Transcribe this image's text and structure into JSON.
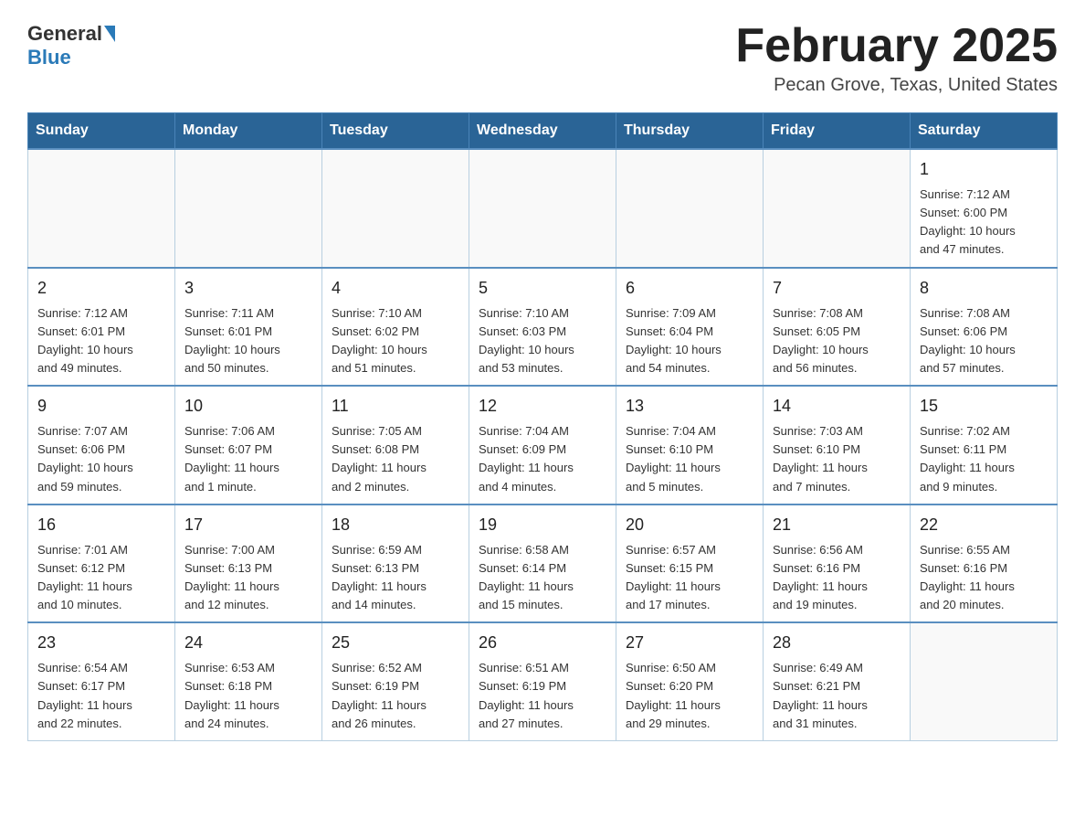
{
  "header": {
    "logo_general": "General",
    "logo_blue": "Blue",
    "month_title": "February 2025",
    "location": "Pecan Grove, Texas, United States"
  },
  "weekdays": [
    "Sunday",
    "Monday",
    "Tuesday",
    "Wednesday",
    "Thursday",
    "Friday",
    "Saturday"
  ],
  "weeks": [
    [
      {
        "day": "",
        "info": ""
      },
      {
        "day": "",
        "info": ""
      },
      {
        "day": "",
        "info": ""
      },
      {
        "day": "",
        "info": ""
      },
      {
        "day": "",
        "info": ""
      },
      {
        "day": "",
        "info": ""
      },
      {
        "day": "1",
        "info": "Sunrise: 7:12 AM\nSunset: 6:00 PM\nDaylight: 10 hours\nand 47 minutes."
      }
    ],
    [
      {
        "day": "2",
        "info": "Sunrise: 7:12 AM\nSunset: 6:01 PM\nDaylight: 10 hours\nand 49 minutes."
      },
      {
        "day": "3",
        "info": "Sunrise: 7:11 AM\nSunset: 6:01 PM\nDaylight: 10 hours\nand 50 minutes."
      },
      {
        "day": "4",
        "info": "Sunrise: 7:10 AM\nSunset: 6:02 PM\nDaylight: 10 hours\nand 51 minutes."
      },
      {
        "day": "5",
        "info": "Sunrise: 7:10 AM\nSunset: 6:03 PM\nDaylight: 10 hours\nand 53 minutes."
      },
      {
        "day": "6",
        "info": "Sunrise: 7:09 AM\nSunset: 6:04 PM\nDaylight: 10 hours\nand 54 minutes."
      },
      {
        "day": "7",
        "info": "Sunrise: 7:08 AM\nSunset: 6:05 PM\nDaylight: 10 hours\nand 56 minutes."
      },
      {
        "day": "8",
        "info": "Sunrise: 7:08 AM\nSunset: 6:06 PM\nDaylight: 10 hours\nand 57 minutes."
      }
    ],
    [
      {
        "day": "9",
        "info": "Sunrise: 7:07 AM\nSunset: 6:06 PM\nDaylight: 10 hours\nand 59 minutes."
      },
      {
        "day": "10",
        "info": "Sunrise: 7:06 AM\nSunset: 6:07 PM\nDaylight: 11 hours\nand 1 minute."
      },
      {
        "day": "11",
        "info": "Sunrise: 7:05 AM\nSunset: 6:08 PM\nDaylight: 11 hours\nand 2 minutes."
      },
      {
        "day": "12",
        "info": "Sunrise: 7:04 AM\nSunset: 6:09 PM\nDaylight: 11 hours\nand 4 minutes."
      },
      {
        "day": "13",
        "info": "Sunrise: 7:04 AM\nSunset: 6:10 PM\nDaylight: 11 hours\nand 5 minutes."
      },
      {
        "day": "14",
        "info": "Sunrise: 7:03 AM\nSunset: 6:10 PM\nDaylight: 11 hours\nand 7 minutes."
      },
      {
        "day": "15",
        "info": "Sunrise: 7:02 AM\nSunset: 6:11 PM\nDaylight: 11 hours\nand 9 minutes."
      }
    ],
    [
      {
        "day": "16",
        "info": "Sunrise: 7:01 AM\nSunset: 6:12 PM\nDaylight: 11 hours\nand 10 minutes."
      },
      {
        "day": "17",
        "info": "Sunrise: 7:00 AM\nSunset: 6:13 PM\nDaylight: 11 hours\nand 12 minutes."
      },
      {
        "day": "18",
        "info": "Sunrise: 6:59 AM\nSunset: 6:13 PM\nDaylight: 11 hours\nand 14 minutes."
      },
      {
        "day": "19",
        "info": "Sunrise: 6:58 AM\nSunset: 6:14 PM\nDaylight: 11 hours\nand 15 minutes."
      },
      {
        "day": "20",
        "info": "Sunrise: 6:57 AM\nSunset: 6:15 PM\nDaylight: 11 hours\nand 17 minutes."
      },
      {
        "day": "21",
        "info": "Sunrise: 6:56 AM\nSunset: 6:16 PM\nDaylight: 11 hours\nand 19 minutes."
      },
      {
        "day": "22",
        "info": "Sunrise: 6:55 AM\nSunset: 6:16 PM\nDaylight: 11 hours\nand 20 minutes."
      }
    ],
    [
      {
        "day": "23",
        "info": "Sunrise: 6:54 AM\nSunset: 6:17 PM\nDaylight: 11 hours\nand 22 minutes."
      },
      {
        "day": "24",
        "info": "Sunrise: 6:53 AM\nSunset: 6:18 PM\nDaylight: 11 hours\nand 24 minutes."
      },
      {
        "day": "25",
        "info": "Sunrise: 6:52 AM\nSunset: 6:19 PM\nDaylight: 11 hours\nand 26 minutes."
      },
      {
        "day": "26",
        "info": "Sunrise: 6:51 AM\nSunset: 6:19 PM\nDaylight: 11 hours\nand 27 minutes."
      },
      {
        "day": "27",
        "info": "Sunrise: 6:50 AM\nSunset: 6:20 PM\nDaylight: 11 hours\nand 29 minutes."
      },
      {
        "day": "28",
        "info": "Sunrise: 6:49 AM\nSunset: 6:21 PM\nDaylight: 11 hours\nand 31 minutes."
      },
      {
        "day": "",
        "info": ""
      }
    ]
  ]
}
